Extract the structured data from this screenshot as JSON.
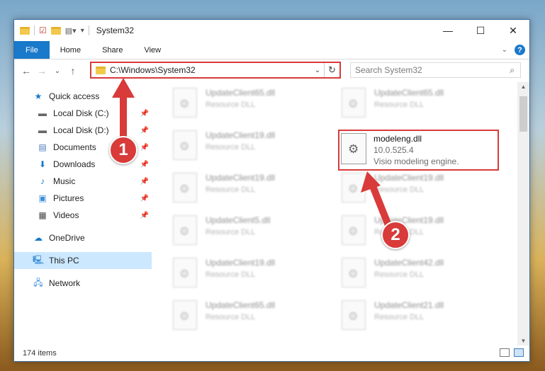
{
  "window": {
    "title": "System32"
  },
  "caption": {
    "minimize": "—",
    "maximize": "☐",
    "close": "✕"
  },
  "ribbon": {
    "tabs": [
      "File",
      "Home",
      "Share",
      "View"
    ],
    "help": "?"
  },
  "nav": {
    "back": "←",
    "forward": "→",
    "recent": "⌄",
    "up": "↑"
  },
  "address": {
    "path": "C:\\Windows\\System32",
    "dropdown": "⌄",
    "refresh": "↻"
  },
  "search": {
    "placeholder": "Search System32",
    "icon": "🔍"
  },
  "sidebar": {
    "quick_access": "Quick access",
    "items": [
      {
        "label": "Local Disk (C:)",
        "icon": "drive-icon"
      },
      {
        "label": "Local Disk (D:)",
        "icon": "drive-icon"
      },
      {
        "label": "Documents",
        "icon": "documents-icon"
      },
      {
        "label": "Downloads",
        "icon": "downloads-icon"
      },
      {
        "label": "Music",
        "icon": "music-icon"
      },
      {
        "label": "Pictures",
        "icon": "pictures-icon"
      },
      {
        "label": "Videos",
        "icon": "videos-icon"
      }
    ],
    "onedrive": "OneDrive",
    "thispc": "This PC",
    "network": "Network"
  },
  "files_bg": [
    {
      "name": "UpdateClient65.dll",
      "type": "Resource DLL"
    },
    {
      "name": "UpdateClient65.dll",
      "type": "Resource DLL"
    },
    {
      "name": "UpdateClient19.dll",
      "type": "Resource DLL"
    },
    {
      "name": "UpdateClient19.dll",
      "type": "Resource DLL"
    },
    {
      "name": "UpdateClient19.dll",
      "type": "Resource DLL"
    },
    {
      "name": "UpdateClient5.dll",
      "type": "Resource DLL"
    },
    {
      "name": "UpdateClient19.dll",
      "type": "Resource DLL"
    },
    {
      "name": "UpdateClient19.dll",
      "type": "Resource DLL"
    },
    {
      "name": "UpdateClient42.dll",
      "type": "Resource DLL"
    },
    {
      "name": "UpdateClient65.dll",
      "type": "Resource DLL"
    },
    {
      "name": "UpdateClient21.dll",
      "type": "Resource DLL"
    }
  ],
  "selected_file": {
    "name": "modeleng.dll",
    "version": "10.0.525.4",
    "description": "Visio modeling engine."
  },
  "status": {
    "count": "174 items"
  },
  "annotations": {
    "step1": "1",
    "step2": "2",
    "color": "#d93a3a"
  }
}
